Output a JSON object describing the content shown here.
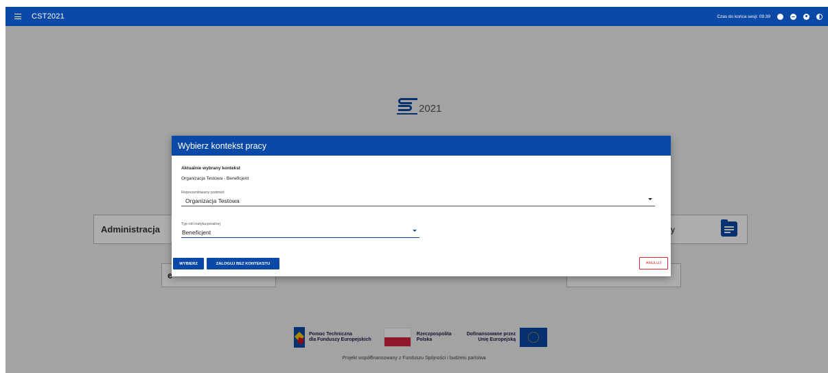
{
  "topbar": {
    "title": "CST2021",
    "session_label": "Czas do końca sesji: 09:39",
    "icons": [
      "menu-icon",
      "clock-icon",
      "globe-icon",
      "user-icon",
      "contrast-icon"
    ]
  },
  "logo": {
    "year": "2021"
  },
  "cards": {
    "admin": "Administracja",
    "right_partial": "y",
    "e_partial": "e"
  },
  "modal": {
    "title": "Wybierz kontekst pracy",
    "current_label": "Aktualnie wybrany kontekst",
    "current_value": "Organizacja Testowa - Beneficjent",
    "field1": {
      "label": "Reprezentowany podmiot",
      "value": "Organizacja Testowa"
    },
    "field2": {
      "label": "Typ roli instytucjonalnej",
      "value": "Beneficjent"
    },
    "buttons": {
      "select": "WYBIERZ",
      "no_context": "ZALOGUJ BEZ KONTEKSTU",
      "cancel": "ANULUJ"
    }
  },
  "footer": {
    "fe_text_1": "Pomoc Techniczna",
    "fe_text_2": "dla Funduszy Europejskich",
    "pl_text_1": "Rzeczpospolita",
    "pl_text_2": "Polska",
    "eu_text_1": "Dofinansowane przez",
    "eu_text_2": "Unię Europejską",
    "note": "Projekt współfinansowany z Funduszu Spójności i budżetu państwa"
  }
}
